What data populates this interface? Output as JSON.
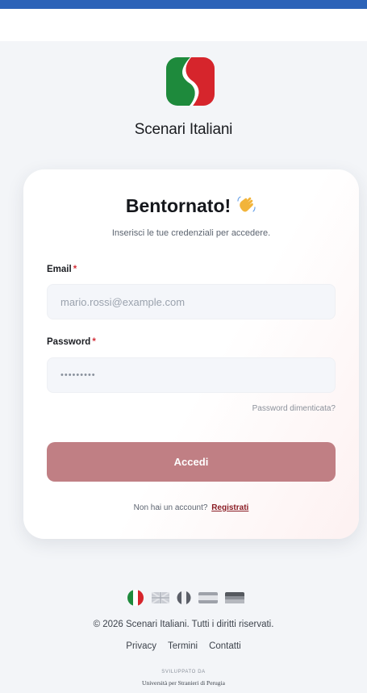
{
  "app": {
    "name": "Scenari Italiani"
  },
  "login": {
    "title": "Bentornato!",
    "subtitle": "Inserisci le tue credenziali per accedere.",
    "email_label": "Email",
    "email_placeholder": "mario.rossi@example.com",
    "password_label": "Password",
    "password_value": "•••••••••",
    "required_mark": "*",
    "forgot_password": "Password dimenticata?",
    "submit_label": "Accedi",
    "no_account_text": "Non hai un account?",
    "register_link": "Registrati"
  },
  "footer": {
    "language_flags": [
      "flag-italy-icon",
      "flag-uk-icon",
      "flag-france-icon",
      "flag-spain-icon",
      "flag-germany-icon"
    ],
    "copyright": "© 2026 Scenari Italiani. Tutti i diritti riservati.",
    "links": [
      "Privacy",
      "Termini",
      "Contatti"
    ],
    "developed_by": "SVILUPPATO DA",
    "university": "Università per Stranieri di Perugia"
  },
  "colors": {
    "topbar": "#2c63b8",
    "logo_green": "#1e8a3c",
    "logo_red": "#d6252c",
    "submit_button": "#c07f84",
    "required": "#d3313a",
    "register_link": "#8a1c24"
  }
}
